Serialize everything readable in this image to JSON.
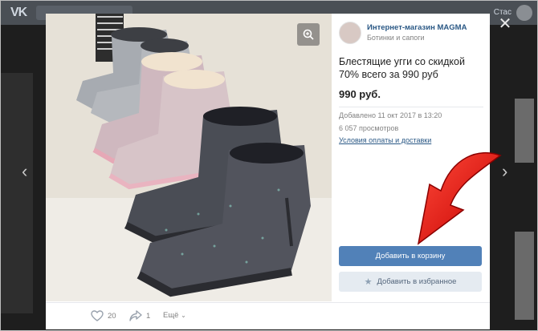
{
  "vk": {
    "logo": "VK",
    "right_text": "Стас"
  },
  "shop": {
    "name": "Интернет-магазин MAGMA",
    "category": "Ботинки и сапоги"
  },
  "product": {
    "title": "Блестящие угги со скидкой 70% всего за 990 руб",
    "price": "990 руб.",
    "added": "Добавлено 11 окт 2017 в 13:20",
    "views": "6 057 просмотров",
    "terms_link": "Условия оплаты и доставки"
  },
  "actions": {
    "add_to_cart": "Добавить в корзину",
    "add_to_favorites": "Добавить в избранное"
  },
  "bottom": {
    "likes": "20",
    "shares": "1",
    "more": "Ещё"
  },
  "colors": {
    "accent": "#5181b8",
    "link": "#2a5885",
    "arrow": "#e81212"
  },
  "icons": {
    "zoom": "zoom-icon",
    "close": "close-icon",
    "like": "heart-icon",
    "share": "share-icon",
    "star": "star-icon",
    "prev": "chevron-left-icon",
    "next": "chevron-right-icon"
  }
}
